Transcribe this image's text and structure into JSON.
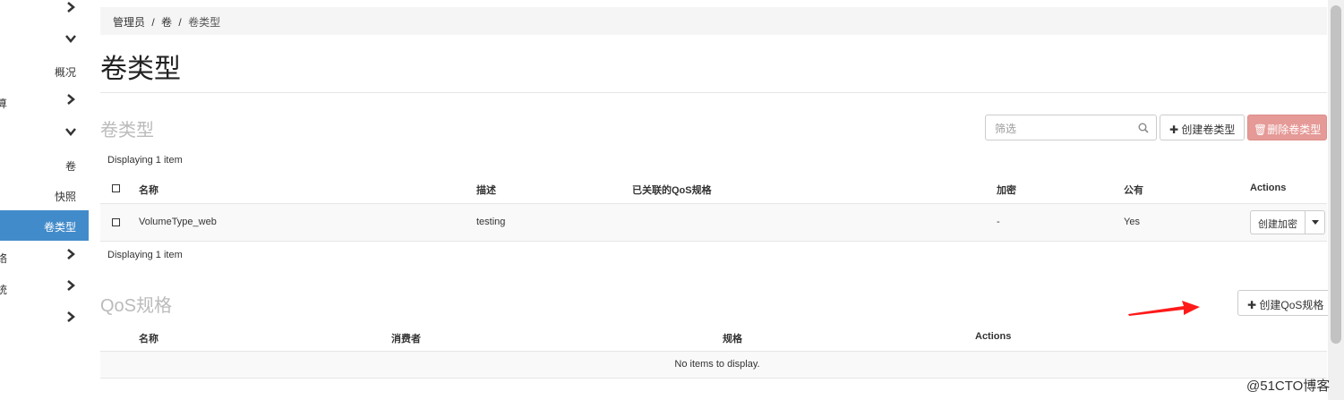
{
  "sidebar": {
    "items": [
      {
        "label": "",
        "type": "chevron-right"
      },
      {
        "label": "",
        "type": "chevron-down"
      },
      {
        "label": "概况",
        "type": "link"
      },
      {
        "label": "算",
        "type": "chevron-right-cut"
      },
      {
        "label": "",
        "type": "chevron-down"
      },
      {
        "label": "卷",
        "type": "link"
      },
      {
        "label": "快照",
        "type": "link"
      },
      {
        "label": "卷类型",
        "type": "active"
      },
      {
        "label": "络",
        "type": "chevron-right-cut"
      },
      {
        "label": "统",
        "type": "chevron-right-cut"
      },
      {
        "label": "",
        "type": "chevron-right"
      }
    ]
  },
  "breadcrumb": {
    "part1": "管理员",
    "part2": "卷",
    "sep": "/",
    "current": "卷类型"
  },
  "page_title": "卷类型",
  "volume_types": {
    "title": "卷类型",
    "filter_placeholder": "筛选",
    "create_label": "创建卷类型",
    "delete_label": "删除卷类型",
    "count_top": "Displaying 1 item",
    "count_bottom": "Displaying 1 item",
    "headers": {
      "name": "名称",
      "description": "描述",
      "qos": "已关联的QoS规格",
      "encrypted": "加密",
      "public": "公有",
      "actions": "Actions"
    },
    "rows": [
      {
        "name": "VolumeType_web",
        "description": "testing",
        "qos": "",
        "encrypted": "-",
        "public": "Yes",
        "action": "创建加密"
      }
    ]
  },
  "qos": {
    "title": "QoS规格",
    "create_label": "创建QoS规格",
    "headers": {
      "name": "名称",
      "consumer": "消费者",
      "spec": "规格",
      "actions": "Actions"
    },
    "empty": "No items to display."
  },
  "watermark": "@51CTO博客",
  "colors": {
    "active": "#428bca",
    "danger": "#e59a97",
    "arrow": "#ff1a1a"
  }
}
